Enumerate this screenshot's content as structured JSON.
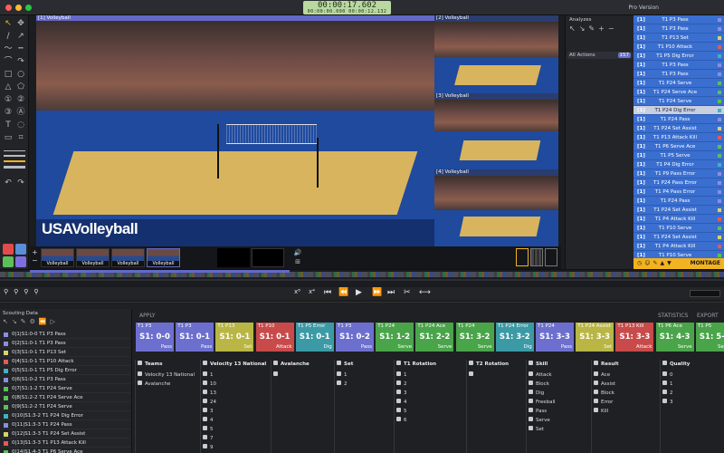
{
  "titlebar": {
    "timecode_main": "00:00:17.602",
    "timecode_sub": "00:00:00.000   00:00:12.132",
    "pro_version": "Pro Version"
  },
  "panes": {
    "p1": "[1] Volleyball",
    "p2": "[2] Volleyball",
    "p3": "[3] Volleyball",
    "p4": "[4] Volleyball",
    "banner": "USAVolleyball"
  },
  "thumbs": [
    "Volleyball",
    "Volleyball",
    "Volleyball",
    "Volleyball"
  ],
  "analyzes": {
    "title": "Analyzes",
    "all_actions": "All Actions",
    "count": "157"
  },
  "eventlist": [
    {
      "code": "[1]",
      "text": "T1 P3 Pass",
      "color": "#8a8fe0"
    },
    {
      "code": "[1]",
      "text": "T1 P3 Pass",
      "color": "#8a8fe0"
    },
    {
      "code": "[1]",
      "text": "T1 P13 Set",
      "color": "#d6d36a"
    },
    {
      "code": "[1]",
      "text": "T1 P10 Attack",
      "color": "#e05a5a"
    },
    {
      "code": "[1]",
      "text": "T1 P5 Dig Error",
      "color": "#3fb3c0"
    },
    {
      "code": "[1]",
      "text": "T1 P3 Pass",
      "color": "#8a8fe0"
    },
    {
      "code": "[1]",
      "text": "T1 P3 Pass",
      "color": "#8a8fe0"
    },
    {
      "code": "[1]",
      "text": "T1 P24 Serve",
      "color": "#5cc05a"
    },
    {
      "code": "[1]",
      "text": "T1 P24 Serve Ace",
      "color": "#5cc05a"
    },
    {
      "code": "[1]",
      "text": "T1 P24 Serve",
      "color": "#5cc05a"
    },
    {
      "code": "[1]",
      "text": "T1 P24 Dig Error",
      "color": "#3fb3c0"
    },
    {
      "code": "[1]",
      "text": "T1 P24 Pass",
      "color": "#8a8fe0"
    },
    {
      "code": "[1]",
      "text": "T1 P24 Set Assist",
      "color": "#d6d36a"
    },
    {
      "code": "[1]",
      "text": "T1 P13 Attack Kill",
      "color": "#e05a5a"
    },
    {
      "code": "[1]",
      "text": "T1 P6 Serve Ace",
      "color": "#5cc05a"
    },
    {
      "code": "[1]",
      "text": "T1 P5 Serve",
      "color": "#5cc05a"
    },
    {
      "code": "[1]",
      "text": "T1 P4 Dig Error",
      "color": "#3fb3c0"
    },
    {
      "code": "[1]",
      "text": "T1 P9 Pass Error",
      "color": "#8a8fe0"
    },
    {
      "code": "[1]",
      "text": "T1 P24 Pass Error",
      "color": "#8a8fe0"
    },
    {
      "code": "[1]",
      "text": "T1 P4 Pass Error",
      "color": "#8a8fe0"
    },
    {
      "code": "[1]",
      "text": "T1 P24 Pass",
      "color": "#8a8fe0"
    },
    {
      "code": "[1]",
      "text": "T1 P24 Set Assist",
      "color": "#d6d36a"
    },
    {
      "code": "[1]",
      "text": "T1 P4 Attack Kill",
      "color": "#e05a5a"
    },
    {
      "code": "[1]",
      "text": "T1 P10 Serve",
      "color": "#5cc05a"
    },
    {
      "code": "[1]",
      "text": "T1 P24 Set Assist",
      "color": "#d6d36a"
    },
    {
      "code": "[1]",
      "text": "T1 P4 Attack Kill",
      "color": "#e05a5a"
    },
    {
      "code": "[1]",
      "text": "T1 P10 Serve",
      "color": "#5cc05a"
    }
  ],
  "montage": {
    "label": "MONTAGE"
  },
  "bottom": {
    "apply": "APPLY",
    "statistics": "STATISTICS",
    "export": "EXPORT",
    "scouting_title": "Scouting Data"
  },
  "scouting": [
    {
      "text": "0|1|S1:0-0 T1 P3 Pass",
      "color": "#8a8fe0"
    },
    {
      "text": "0|2|S1:0-1 T1 P3 Pass",
      "color": "#8a8fe0"
    },
    {
      "text": "0|3|S1:0-1 T1 P13 Set",
      "color": "#d6d36a"
    },
    {
      "text": "0|4|S1:0-1 T1 P10 Attack",
      "color": "#e05a5a"
    },
    {
      "text": "0|5|S1:0-1 T1 P5 Dig Error",
      "color": "#3fb3c0"
    },
    {
      "text": "0|6|S1:0-2 T1 P3 Pass",
      "color": "#8a8fe0"
    },
    {
      "text": "0|7|S1:1-2 T1 P24 Serve",
      "color": "#5cc05a"
    },
    {
      "text": "0|8|S1:2-2 T1 P24 Serve Ace",
      "color": "#5cc05a"
    },
    {
      "text": "0|9|S1:2-2 T1 P24 Serve",
      "color": "#5cc05a"
    },
    {
      "text": "0|10|S1:3-2 T1 P24 Dig Error",
      "color": "#3fb3c0"
    },
    {
      "text": "0|11|S1:3-3 T1 P24 Pass",
      "color": "#8a8fe0"
    },
    {
      "text": "0|12|S1:3-3 T1 P24 Set Assist",
      "color": "#d6d36a"
    },
    {
      "text": "0|13|S1:3-3 T1 P13 Attack Kill",
      "color": "#e05a5a"
    },
    {
      "text": "0|14|S1:4-3 T1 P6 Serve Ace",
      "color": "#5cc05a"
    }
  ],
  "tiles": [
    {
      "top": "T1 P3",
      "score": "S1: 0-0",
      "skill": "Pass",
      "color": "#6d6fcf"
    },
    {
      "top": "T1 P3",
      "score": "S1: 0-1",
      "skill": "Pass",
      "color": "#6d6fcf"
    },
    {
      "top": "T1 P13",
      "score": "S1: 0-1",
      "skill": "Set",
      "color": "#b9b645"
    },
    {
      "top": "T1 P10",
      "score": "S1: 0-1",
      "skill": "Attack",
      "color": "#c94a4a"
    },
    {
      "top": "T1 P5 Error",
      "score": "S1: 0-1",
      "skill": "Dig",
      "color": "#3c9aa6"
    },
    {
      "top": "T1 P3",
      "score": "S1: 0-2",
      "skill": "Pass",
      "color": "#6d6fcf"
    },
    {
      "top": "T1 P24",
      "score": "S1: 1-2",
      "skill": "Serve",
      "color": "#4aa44a"
    },
    {
      "top": "T1 P24 Ace",
      "score": "S1: 2-2",
      "skill": "Serve",
      "color": "#4aa44a"
    },
    {
      "top": "T1 P24",
      "score": "S1: 3-2",
      "skill": "Serve",
      "color": "#4aa44a"
    },
    {
      "top": "T1 P24 Error",
      "score": "S1: 3-2",
      "skill": "Dig",
      "color": "#3c9aa6"
    },
    {
      "top": "T1 P24",
      "score": "S1: 3-3",
      "skill": "Pass",
      "color": "#6d6fcf"
    },
    {
      "top": "T1 P24 Assist",
      "score": "S1: 3-3",
      "skill": "Set",
      "color": "#b9b645"
    },
    {
      "top": "T1 P13 Kill",
      "score": "S1: 3-3",
      "skill": "Attack",
      "color": "#c94a4a"
    },
    {
      "top": "T1 P6 Ace",
      "score": "S1: 4-3",
      "skill": "Serve",
      "color": "#4aa44a"
    },
    {
      "top": "T1 P5",
      "score": "S1: 5-3",
      "skill": "Serve",
      "color": "#4aa44a"
    }
  ],
  "filters": [
    {
      "header": "Teams",
      "items": [
        "Velocity 13 National",
        "Avalanche"
      ]
    },
    {
      "header": "Velocity 13 National",
      "items": [
        "1",
        "10",
        "13",
        "24",
        "3",
        "4",
        "5",
        "7",
        "9"
      ]
    },
    {
      "header": "Avalanche",
      "items": [
        ""
      ]
    },
    {
      "header": "Set",
      "items": [
        "1",
        "2"
      ]
    },
    {
      "header": "T1 Rotation",
      "items": [
        "1",
        "2",
        "3",
        "4",
        "5",
        "6"
      ]
    },
    {
      "header": "T2 Rotation",
      "items": [
        ""
      ]
    },
    {
      "header": "Skill",
      "items": [
        "Attack",
        "Block",
        "Dig",
        "Freeball",
        "Pass",
        "Serve",
        "Set"
      ]
    },
    {
      "header": "Result",
      "items": [
        "Ace",
        "Assist",
        "Block",
        "Error",
        "Kill"
      ]
    },
    {
      "header": "Quality",
      "items": [
        "0",
        "1",
        "2",
        "3"
      ]
    }
  ]
}
